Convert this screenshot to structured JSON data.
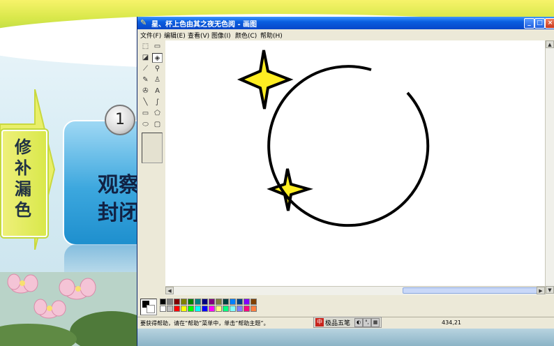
{
  "slide": {
    "side_label_chars": [
      "修",
      "补",
      "漏",
      "色"
    ],
    "step_number": "1",
    "box_line1": "观察",
    "box_line2": "封闭"
  },
  "paint": {
    "title": "星、杯上色由其之夜无色阅 - 画图",
    "window_buttons": {
      "minimize": "_",
      "maximize": "□",
      "close": "×"
    },
    "menu": [
      "文件(F)",
      "编辑(E)",
      "查看(V)",
      "图像(I)",
      "颜色(C)",
      "帮助(H)"
    ],
    "tools": [
      {
        "name": "free-select-tool",
        "glyph": "⬚"
      },
      {
        "name": "rect-select-tool",
        "glyph": "▭"
      },
      {
        "name": "eraser-tool",
        "glyph": "◪"
      },
      {
        "name": "fill-tool",
        "glyph": "◈"
      },
      {
        "name": "color-picker-tool",
        "glyph": "⟋"
      },
      {
        "name": "magnifier-tool",
        "glyph": "⚲"
      },
      {
        "name": "pencil-tool",
        "glyph": "✎"
      },
      {
        "name": "brush-tool",
        "glyph": "♙"
      },
      {
        "name": "airbrush-tool",
        "glyph": "✇"
      },
      {
        "name": "text-tool",
        "glyph": "A"
      },
      {
        "name": "line-tool",
        "glyph": "╲"
      },
      {
        "name": "curve-tool",
        "glyph": "∫"
      },
      {
        "name": "rectangle-tool",
        "glyph": "▭"
      },
      {
        "name": "polygon-tool",
        "glyph": "⬠"
      },
      {
        "name": "ellipse-tool",
        "glyph": "⬭"
      },
      {
        "name": "rounded-rect-tool",
        "glyph": "▢"
      }
    ],
    "selected_tool": "fill-tool",
    "palette_colors": [
      "#000000",
      "#808080",
      "#800000",
      "#808000",
      "#008000",
      "#008080",
      "#000080",
      "#800080",
      "#808040",
      "#004040",
      "#0080ff",
      "#004080",
      "#8000ff",
      "#804000",
      "#ffffff",
      "#c0c0c0",
      "#ff0000",
      "#ffff00",
      "#00ff00",
      "#00ffff",
      "#0000ff",
      "#ff00ff",
      "#ffff80",
      "#00ff80",
      "#80ffff",
      "#8080ff",
      "#ff0080",
      "#ff8040"
    ],
    "foreground_color": "#000000",
    "background_color": "#ffffff",
    "status_text": "要获得帮助，请在“帮助”菜单中，单击“帮助主题”。",
    "cursor_coords": "434,21",
    "ime": {
      "logo": "中",
      "name": "极品五笔"
    },
    "drawing": {
      "star_fill": "#ffee22",
      "outline": "#000000"
    }
  }
}
